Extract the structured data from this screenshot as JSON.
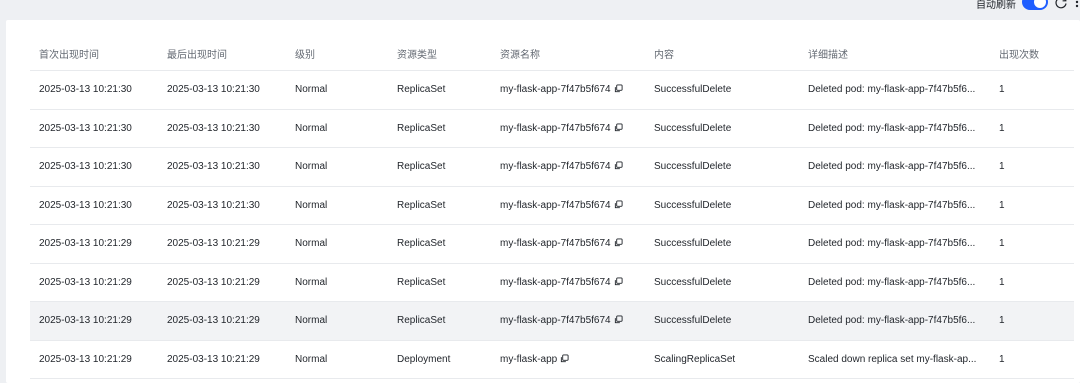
{
  "toolbar": {
    "auto_refresh_label": "自动刷新",
    "auto_refresh_on": true,
    "refresh_icon": "refresh-icon",
    "accent_color": "#1f5eff"
  },
  "table": {
    "columns": [
      "首次出现时间",
      "最后出现时间",
      "级别",
      "资源类型",
      "资源名称",
      "内容",
      "详细描述",
      "出现次数"
    ],
    "rows": [
      {
        "first": "2025-03-13 10:21:30",
        "last": "2025-03-13 10:21:30",
        "level": "Normal",
        "kind": "ReplicaSet",
        "name": "my-flask-app-7f47b5f674",
        "reason": "SuccessfulDelete",
        "message": "Deleted pod: my-flask-app-7f47b5f6...",
        "count": "1"
      },
      {
        "first": "2025-03-13 10:21:30",
        "last": "2025-03-13 10:21:30",
        "level": "Normal",
        "kind": "ReplicaSet",
        "name": "my-flask-app-7f47b5f674",
        "reason": "SuccessfulDelete",
        "message": "Deleted pod: my-flask-app-7f47b5f6...",
        "count": "1"
      },
      {
        "first": "2025-03-13 10:21:30",
        "last": "2025-03-13 10:21:30",
        "level": "Normal",
        "kind": "ReplicaSet",
        "name": "my-flask-app-7f47b5f674",
        "reason": "SuccessfulDelete",
        "message": "Deleted pod: my-flask-app-7f47b5f6...",
        "count": "1"
      },
      {
        "first": "2025-03-13 10:21:30",
        "last": "2025-03-13 10:21:30",
        "level": "Normal",
        "kind": "ReplicaSet",
        "name": "my-flask-app-7f47b5f674",
        "reason": "SuccessfulDelete",
        "message": "Deleted pod: my-flask-app-7f47b5f6...",
        "count": "1"
      },
      {
        "first": "2025-03-13 10:21:29",
        "last": "2025-03-13 10:21:29",
        "level": "Normal",
        "kind": "ReplicaSet",
        "name": "my-flask-app-7f47b5f674",
        "reason": "SuccessfulDelete",
        "message": "Deleted pod: my-flask-app-7f47b5f6...",
        "count": "1"
      },
      {
        "first": "2025-03-13 10:21:29",
        "last": "2025-03-13 10:21:29",
        "level": "Normal",
        "kind": "ReplicaSet",
        "name": "my-flask-app-7f47b5f674",
        "reason": "SuccessfulDelete",
        "message": "Deleted pod: my-flask-app-7f47b5f6...",
        "count": "1"
      },
      {
        "first": "2025-03-13 10:21:29",
        "last": "2025-03-13 10:21:29",
        "level": "Normal",
        "kind": "ReplicaSet",
        "name": "my-flask-app-7f47b5f674",
        "reason": "SuccessfulDelete",
        "message": "Deleted pod: my-flask-app-7f47b5f6...",
        "count": "1"
      },
      {
        "first": "2025-03-13 10:21:29",
        "last": "2025-03-13 10:21:29",
        "level": "Normal",
        "kind": "Deployment",
        "name": "my-flask-app",
        "reason": "ScalingReplicaSet",
        "message": "Scaled down replica set my-flask-ap...",
        "count": "1"
      }
    ],
    "highlighted_row": 6,
    "copy_icon": "copy-icon"
  }
}
